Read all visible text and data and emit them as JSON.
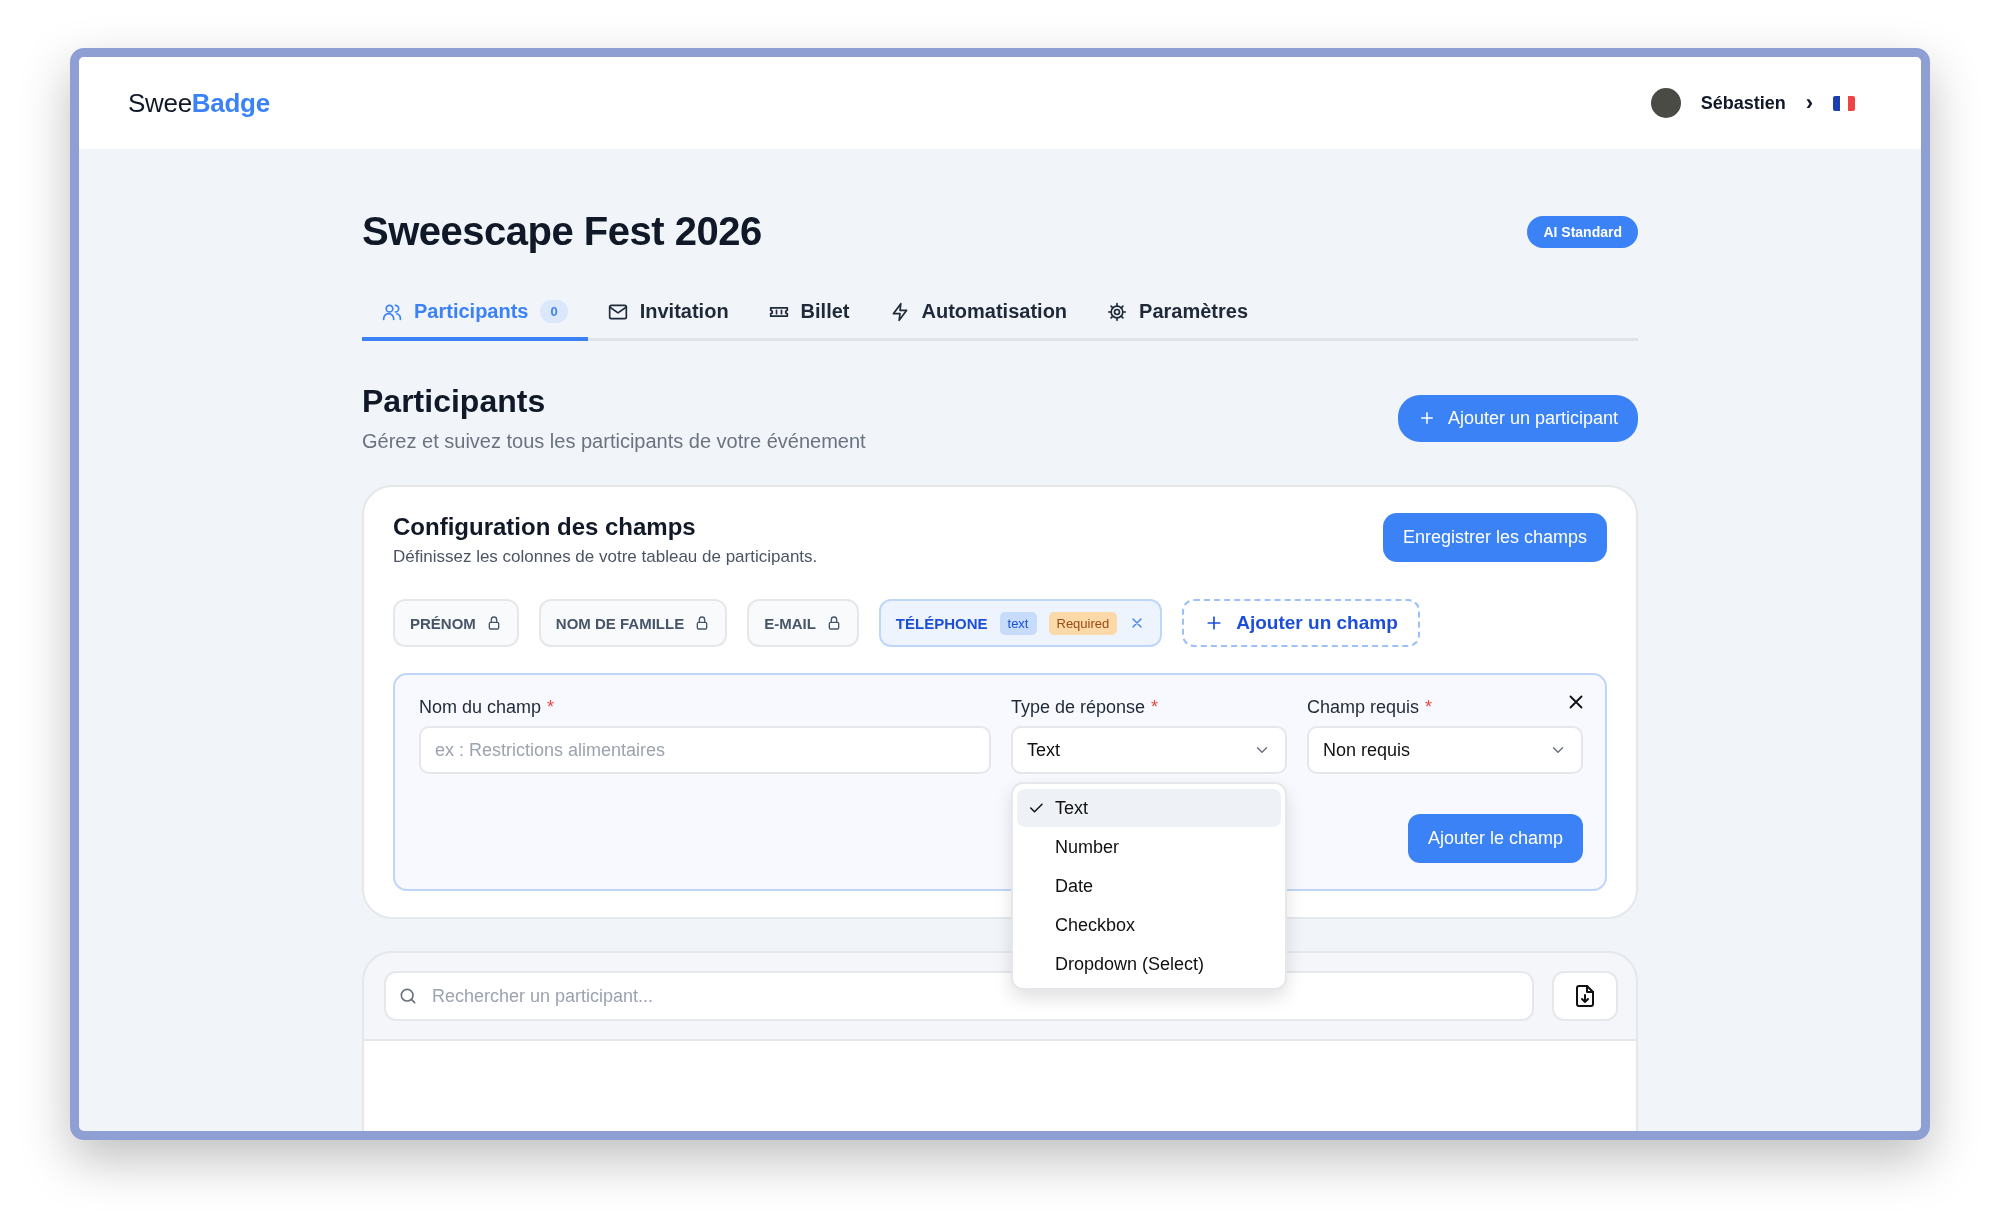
{
  "header": {
    "logo_plain": "Swee",
    "logo_accent": "Badge",
    "user": "Sébastien",
    "chevron": "›"
  },
  "event": {
    "title": "Sweescape Fest 2026",
    "plan": "AI Standard"
  },
  "tabs": [
    {
      "label": "Participants",
      "selected": true,
      "count": "0"
    },
    {
      "label": "Invitation",
      "selected": false
    },
    {
      "label": "Billet",
      "selected": false
    },
    {
      "label": "Automatisation",
      "selected": false
    },
    {
      "label": "Paramètres",
      "selected": false
    }
  ],
  "section": {
    "title": "Participants",
    "subtitle": "Gérez et suivez tous les participants de votre événement",
    "add_button": "Ajouter un participant"
  },
  "fields_card": {
    "title": "Configuration des champs",
    "subtitle": "Définissez les colonnes de votre tableau de participants.",
    "save_button": "Enregistrer les champs",
    "fields": [
      {
        "kind": "locked",
        "label": "PRÉNOM"
      },
      {
        "kind": "locked",
        "label": "NOM DE FAMILLE"
      },
      {
        "kind": "locked",
        "label": "E-MAIL"
      },
      {
        "kind": "custom",
        "label": "TÉLÉPHONE",
        "type": "text",
        "required": "Required"
      }
    ],
    "add_field": "Ajouter un champ",
    "form": {
      "name_label": "Nom du champ",
      "name_placeholder": "ex : Restrictions alimentaires",
      "type_label": "Type de réponse",
      "type_value": "Text",
      "required_label": "Champ requis",
      "required_value": "Non requis",
      "submit": "Ajouter le champ",
      "required_mark": "*",
      "type_options": [
        {
          "label": "Text",
          "selected": true
        },
        {
          "label": "Number",
          "selected": false
        },
        {
          "label": "Date",
          "selected": false
        },
        {
          "label": "Checkbox",
          "selected": false
        },
        {
          "label": "Dropdown (Select)",
          "selected": false
        }
      ]
    }
  },
  "search": {
    "placeholder": "Rechercher un participant..."
  }
}
